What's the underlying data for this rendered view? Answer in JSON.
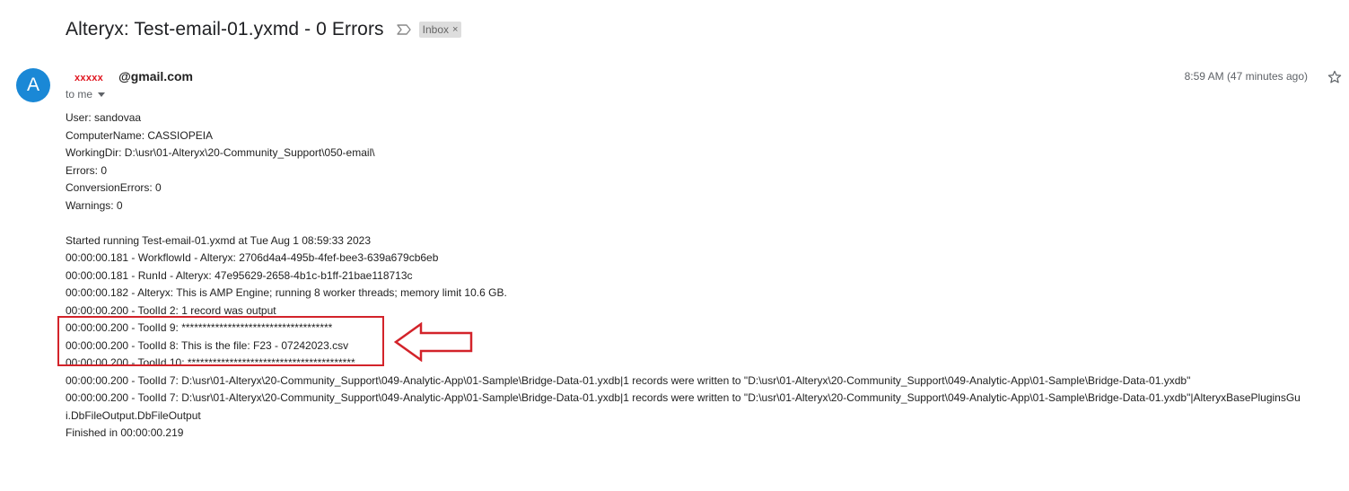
{
  "email": {
    "subject": "Alteryx: Test-email-01.yxmd - 0 Errors",
    "label": "Inbox",
    "label_close": "×",
    "sender": {
      "avatar_letter": "A",
      "redacted_name": "xxxxx",
      "email_suffix": "@gmail.com"
    },
    "recipient": "to me",
    "timestamp": "8:59 AM (47 minutes ago)",
    "body_lines": [
      "User: sandovaa",
      "ComputerName: CASSIOPEIA",
      "WorkingDir: D:\\usr\\01-Alteryx\\20-Community_Support\\050-email\\",
      "Errors: 0",
      "ConversionErrors: 0",
      "Warnings: 0",
      "",
      "Started running Test-email-01.yxmd at Tue Aug  1 08:59:33 2023",
      "00:00:00.181 - WorkflowId - Alteryx: 2706d4a4-495b-4fef-bee3-639a679cb6eb",
      "00:00:00.181 - RunId - Alteryx: 47e95629-2658-4b1c-b1ff-21bae118713c",
      "00:00:00.182 - Alteryx: This is AMP Engine; running 8 worker threads; memory limit 10.6 GB.",
      "00:00:00.200 - ToolId 2: 1 record was output",
      "00:00:00.200 - ToolId 9: ************************************",
      "00:00:00.200 - ToolId 8: This is the file: F23 - 07242023.csv",
      "00:00:00.200 - ToolId 10: ****************************************",
      "00:00:00.200 - ToolId 7: D:\\usr\\01-Alteryx\\20-Community_Support\\049-Analytic-App\\01-Sample\\Bridge-Data-01.yxdb|1 records were written to \"D:\\usr\\01-Alteryx\\20-Community_Support\\049-Analytic-App\\01-Sample\\Bridge-Data-01.yxdb\"",
      "00:00:00.200 - ToolId 7: D:\\usr\\01-Alteryx\\20-Community_Support\\049-Analytic-App\\01-Sample\\Bridge-Data-01.yxdb|1 records were written to \"D:\\usr\\01-Alteryx\\20-Community_Support\\049-Analytic-App\\01-Sample\\Bridge-Data-01.yxdb\"|AlteryxBasePluginsGui.DbFileOutput.DbFileOutput",
      "Finished in 00:00:00.219"
    ]
  },
  "icons": {
    "important": "important-marker-icon",
    "chevron": "chevron-down-icon",
    "star": "star-icon",
    "annotation_arrow": "left-arrow-icon"
  },
  "colors": {
    "avatar_bg": "#1a88d6",
    "redaction": "#e0141e",
    "annotation": "#d3232a",
    "chip_bg": "#dddddd"
  }
}
